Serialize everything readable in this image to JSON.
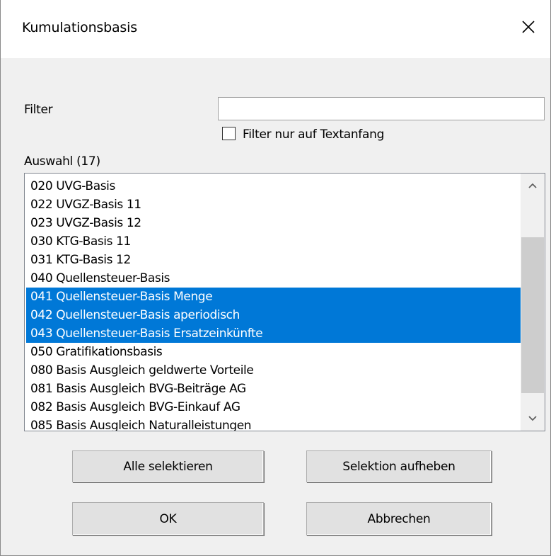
{
  "dialog": {
    "title": "Kumulationsbasis"
  },
  "filter": {
    "label": "Filter",
    "value": "",
    "checkbox_label": "Filter nur auf Textanfang",
    "checkbox_checked": false
  },
  "selection": {
    "label": "Auswahl (17)",
    "items": [
      {
        "text": "020 UVG-Basis",
        "selected": false
      },
      {
        "text": "022 UVGZ-Basis 11",
        "selected": false
      },
      {
        "text": "023 UVGZ-Basis 12",
        "selected": false
      },
      {
        "text": "030 KTG-Basis 11",
        "selected": false
      },
      {
        "text": "031 KTG-Basis 12",
        "selected": false
      },
      {
        "text": "040 Quellensteuer-Basis",
        "selected": false
      },
      {
        "text": "041 Quellensteuer-Basis Menge",
        "selected": true
      },
      {
        "text": "042 Quellensteuer-Basis aperiodisch",
        "selected": true
      },
      {
        "text": "043 Quellensteuer-Basis Ersatzeinkünfte",
        "selected": true
      },
      {
        "text": "050 Gratifikationsbasis",
        "selected": false
      },
      {
        "text": "080 Basis Ausgleich geldwerte Vorteile",
        "selected": false
      },
      {
        "text": "081 Basis Ausgleich BVG-Beiträge AG",
        "selected": false
      },
      {
        "text": "082 Basis Ausgleich BVG-Einkauf AG",
        "selected": false
      },
      {
        "text": "085 Basis Ausgleich Naturalleistungen",
        "selected": false
      }
    ]
  },
  "buttons": {
    "select_all": "Alle selektieren",
    "clear_selection": "Selektion aufheben",
    "ok": "OK",
    "cancel": "Abbrechen"
  },
  "colors": {
    "selection_highlight": "#0078d7",
    "dialog_background": "#f0f0f0"
  }
}
